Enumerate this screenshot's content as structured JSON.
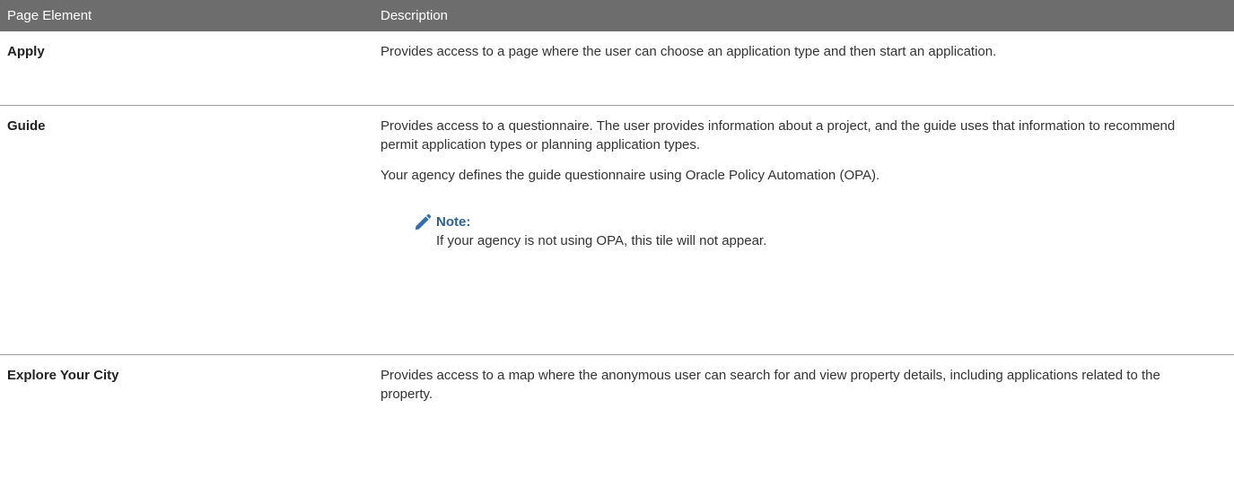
{
  "table": {
    "headers": {
      "element": "Page Element",
      "description": "Description"
    },
    "rows": [
      {
        "term": "Apply",
        "description": "Provides access to a page where the user can choose an application type and then start an application."
      },
      {
        "term": "Guide",
        "description": "Provides access to a questionnaire. The user provides information about a project, and the guide uses that information to recommend permit application types or planning application types.",
        "paragraph2": "Your agency defines the guide questionnaire using Oracle Policy Automation (OPA).",
        "note": {
          "icon": "pencil-icon",
          "title": "Note:",
          "text": "If your agency is not using OPA, this tile will not appear."
        }
      },
      {
        "term": "Explore Your City",
        "description": "Provides access to a map where the anonymous user can search for and view property details, including applications related to the property."
      }
    ]
  },
  "colors": {
    "header_bg": "#6d6d6d",
    "header_text": "#ffffff",
    "note_title": "#2f5f97",
    "note_icon": "#2f6db5",
    "divider": "#9a9a9a"
  }
}
